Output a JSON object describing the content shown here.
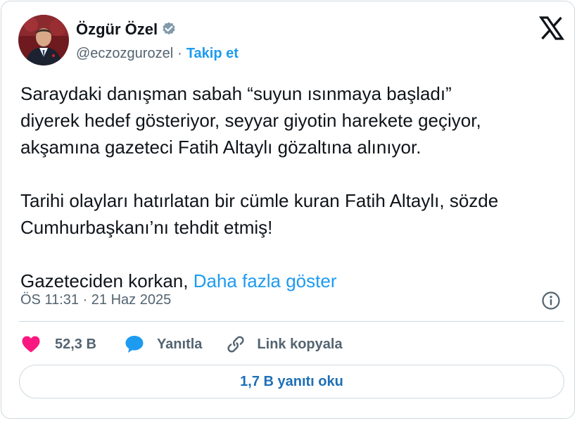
{
  "author": {
    "name": "Özgür Özel",
    "handle": "@eczozgurozel",
    "separator": "·",
    "follow_label": "Takip et",
    "verified_icon": "verified-badge-icon",
    "avatar_icon": "profile-photo"
  },
  "brand": {
    "logo_icon": "x-logo-icon"
  },
  "tweet": {
    "paragraph1_line1": "Saraydaki danışman sabah “suyun ısınmaya başladı”",
    "paragraph1_line2": "diyerek hedef gösteriyor, seyyar giyotin harekete geçiyor,",
    "paragraph1_line3": "akşamına gazeteci Fatih Altaylı gözaltına alınıyor.",
    "paragraph2_line1": "Tarihi olayları hatırlatan bir cümle kuran Fatih Altaylı, sözde",
    "paragraph2_line2": "Cumhurbaşkanı’nı tehdit etmiş!",
    "paragraph3_start": "Gazeteciden korkan, ",
    "show_more": "Daha fazla göster"
  },
  "meta": {
    "timestamp": "ÖS 11:31 · 21 Haz 2025",
    "info_icon": "info-icon"
  },
  "actions": {
    "likes": "52,3 B",
    "reply_label": "Yanıtla",
    "copy_link_label": "Link kopyala"
  },
  "replies": {
    "read_label": "1,7 B yanıtı oku"
  },
  "colors": {
    "accent": "#1d9bf0",
    "like": "#f91880",
    "text": "#0f1419",
    "secondary": "#536471",
    "border": "#cfd9de"
  }
}
